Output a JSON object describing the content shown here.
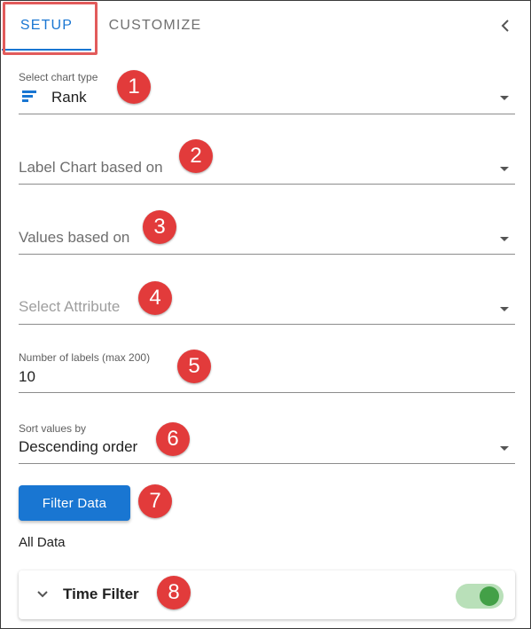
{
  "tabs": [
    {
      "label": "SETUP",
      "active": true
    },
    {
      "label": "CUSTOMIZE",
      "active": false
    }
  ],
  "collapse_icon": "chevron-left-icon",
  "fields": {
    "chart_type": {
      "label": "Select chart type",
      "value": "Rank",
      "icon": "rank-bars-icon"
    },
    "label_chart": {
      "placeholder": "Label Chart based on"
    },
    "values_based": {
      "placeholder": "Values based on"
    },
    "attribute": {
      "placeholder": "Select Attribute"
    },
    "num_labels": {
      "label": "Number of labels (max 200)",
      "value": "10"
    },
    "sort_by": {
      "label": "Sort values by",
      "value": "Descending order"
    }
  },
  "filter_button": {
    "label": "Filter Data"
  },
  "all_data_text": "All Data",
  "time_filter": {
    "title": "Time Filter",
    "enabled": true
  },
  "badges": [
    "1",
    "2",
    "3",
    "4",
    "5",
    "6",
    "7",
    "8"
  ],
  "colors": {
    "accent": "#1976d2",
    "badge": "#e23b3b",
    "highlight": "#e25b5b",
    "toggle_on": "#43a047",
    "toggle_track": "#b9e0b9"
  }
}
